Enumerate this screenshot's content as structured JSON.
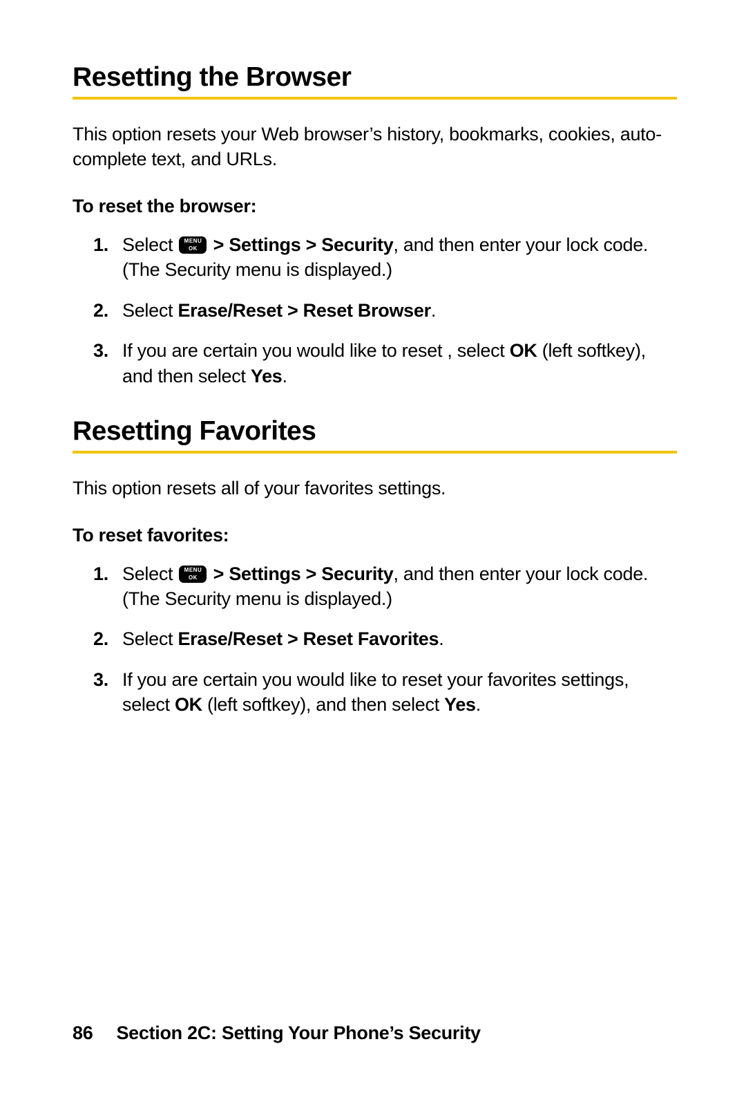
{
  "section1": {
    "heading": "Resetting the Browser",
    "intro": "This option resets your Web browser’s history, bookmarks, cookies, auto-complete text, and URLs.",
    "subhead": "To reset the browser:",
    "step1_pre": "Select ",
    "step1_nav": " > Settings > Security",
    "step1_post": ", and then enter your lock code. (The Security menu is displayed.)",
    "step2_pre": "Select ",
    "step2_bold": "Erase/Reset > Reset Browser",
    "step2_post": ".",
    "step3_pre": "If you are certain you would like to reset , select ",
    "step3_ok": "OK",
    "step3_mid": " (left softkey), and then select ",
    "step3_yes": "Yes",
    "step3_post": "."
  },
  "section2": {
    "heading": "Resetting Favorites",
    "intro": "This option resets all of your favorites settings.",
    "subhead": "To reset favorites:",
    "step1_pre": "Select ",
    "step1_nav": " > Settings > Security",
    "step1_post": ", and then enter your lock code. (The Security menu is displayed.)",
    "step2_pre": "Select ",
    "step2_bold": "Erase/Reset > Reset Favorites",
    "step2_post": ".",
    "step3_pre": "If you are certain you would like to reset your favorites settings, select ",
    "step3_ok": "OK",
    "step3_mid": " (left softkey), and then select ",
    "step3_yes": "Yes",
    "step3_post": "."
  },
  "menu_key": {
    "top": "MENU",
    "bottom": "OK"
  },
  "footer": {
    "page": "86",
    "title": "Section 2C: Setting Your Phone’s Security"
  }
}
